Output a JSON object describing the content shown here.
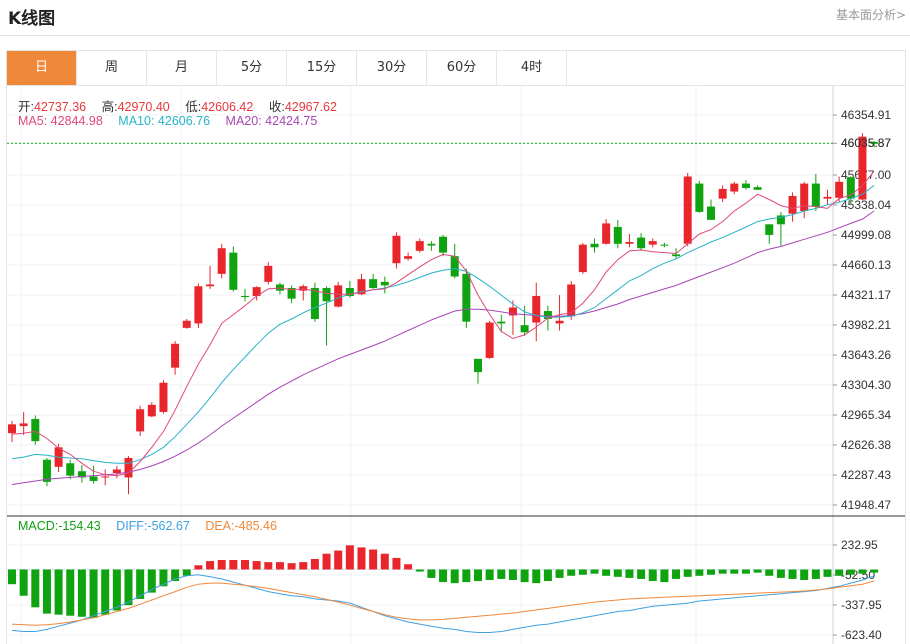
{
  "header": {
    "title": "K线图",
    "analysis_link": "基本面分析>"
  },
  "tabs": [
    {
      "label": "日",
      "active": true
    },
    {
      "label": "周",
      "active": false
    },
    {
      "label": "月",
      "active": false
    },
    {
      "label": "5分",
      "active": false
    },
    {
      "label": "15分",
      "active": false
    },
    {
      "label": "30分",
      "active": false
    },
    {
      "label": "60分",
      "active": false
    },
    {
      "label": "4时",
      "active": false
    }
  ],
  "quote": {
    "open_label": "开:",
    "open": "42737.36",
    "high_label": "高:",
    "high": "42970.40",
    "low_label": "低:",
    "low": "42606.42",
    "close_label": "收:",
    "close": "42967.62"
  },
  "ma_legend": {
    "ma5_label": "MA5:",
    "ma5": "42844.98",
    "ma10_label": "MA10:",
    "ma10": "42606.76",
    "ma20_label": "MA20:",
    "ma20": "42424.75"
  },
  "macd_legend": {
    "macd_label": "MACD:",
    "macd": "-154.43",
    "diff_label": "DIFF:",
    "diff": "-562.67",
    "dea_label": "DEA:",
    "dea": "-485.46"
  },
  "colors": {
    "up": "#e8262b",
    "down": "#0fa30f",
    "ma5": "#e0487a",
    "ma10": "#27b3c8",
    "ma20": "#a845b5",
    "diff": "#3fa0e0",
    "dea": "#f0883a",
    "current": "#12a012",
    "accent": "#f0883a"
  },
  "chart_data": {
    "type": "candlestick",
    "current_price": "46035.87",
    "price_axis": {
      "min": 41948.47,
      "max": 46354.91,
      "ticks": [
        "46354.91",
        "46035.87",
        "45677.00",
        "45338.04",
        "44999.08",
        "44660.13",
        "44321.17",
        "43982.21",
        "43643.26",
        "43304.30",
        "42965.34",
        "42626.38",
        "42287.43",
        "41948.47"
      ]
    },
    "macd_axis": {
      "min": -623.4,
      "max": 232.95,
      "ticks": [
        "232.95",
        "-52.50",
        "-337.95",
        "-623.40"
      ]
    },
    "candles": [
      {
        "o": 42760,
        "h": 42900,
        "l": 42660,
        "c": 42860
      },
      {
        "o": 42840,
        "h": 43000,
        "l": 42740,
        "c": 42870
      },
      {
        "o": 42920,
        "h": 42960,
        "l": 42630,
        "c": 42670
      },
      {
        "o": 42460,
        "h": 42480,
        "l": 42160,
        "c": 42210
      },
      {
        "o": 42380,
        "h": 42640,
        "l": 42320,
        "c": 42600
      },
      {
        "o": 42420,
        "h": 42460,
        "l": 42240,
        "c": 42280
      },
      {
        "o": 42330,
        "h": 42400,
        "l": 42200,
        "c": 42260
      },
      {
        "o": 42270,
        "h": 42390,
        "l": 42190,
        "c": 42220
      },
      {
        "o": 42260,
        "h": 42350,
        "l": 42170,
        "c": 42270
      },
      {
        "o": 42310,
        "h": 42390,
        "l": 42250,
        "c": 42350
      },
      {
        "o": 42260,
        "h": 42500,
        "l": 42070,
        "c": 42480
      },
      {
        "o": 42780,
        "h": 43070,
        "l": 42730,
        "c": 43030
      },
      {
        "o": 42950,
        "h": 43110,
        "l": 42940,
        "c": 43080
      },
      {
        "o": 43000,
        "h": 43360,
        "l": 42980,
        "c": 43330
      },
      {
        "o": 43500,
        "h": 43800,
        "l": 43420,
        "c": 43770
      },
      {
        "o": 43950,
        "h": 44050,
        "l": 43940,
        "c": 44030
      },
      {
        "o": 44000,
        "h": 44450,
        "l": 43950,
        "c": 44420
      },
      {
        "o": 44420,
        "h": 44650,
        "l": 44390,
        "c": 44440
      },
      {
        "o": 44560,
        "h": 44900,
        "l": 44510,
        "c": 44850
      },
      {
        "o": 44800,
        "h": 44870,
        "l": 44360,
        "c": 44380
      },
      {
        "o": 44310,
        "h": 44390,
        "l": 44250,
        "c": 44300
      },
      {
        "o": 44310,
        "h": 44420,
        "l": 44260,
        "c": 44410
      },
      {
        "o": 44470,
        "h": 44690,
        "l": 44440,
        "c": 44650
      },
      {
        "o": 44440,
        "h": 44460,
        "l": 44330,
        "c": 44370
      },
      {
        "o": 44400,
        "h": 44430,
        "l": 44230,
        "c": 44280
      },
      {
        "o": 44370,
        "h": 44440,
        "l": 44260,
        "c": 44420
      },
      {
        "o": 44400,
        "h": 44460,
        "l": 44020,
        "c": 44050
      },
      {
        "o": 44400,
        "h": 44420,
        "l": 43750,
        "c": 44250
      },
      {
        "o": 44190,
        "h": 44470,
        "l": 44180,
        "c": 44430
      },
      {
        "o": 44400,
        "h": 44480,
        "l": 44290,
        "c": 44310
      },
      {
        "o": 44330,
        "h": 44560,
        "l": 44320,
        "c": 44500
      },
      {
        "o": 44500,
        "h": 44560,
        "l": 44390,
        "c": 44400
      },
      {
        "o": 44470,
        "h": 44530,
        "l": 44340,
        "c": 44430
      },
      {
        "o": 44680,
        "h": 45030,
        "l": 44620,
        "c": 44990
      },
      {
        "o": 44730,
        "h": 44800,
        "l": 44710,
        "c": 44760
      },
      {
        "o": 44820,
        "h": 44960,
        "l": 44800,
        "c": 44930
      },
      {
        "o": 44900,
        "h": 44930,
        "l": 44820,
        "c": 44880
      },
      {
        "o": 44980,
        "h": 45000,
        "l": 44760,
        "c": 44800
      },
      {
        "o": 44760,
        "h": 44900,
        "l": 44510,
        "c": 44530
      },
      {
        "o": 44560,
        "h": 44620,
        "l": 43950,
        "c": 44020
      },
      {
        "o": 43600,
        "h": 43600,
        "l": 43320,
        "c": 43450
      },
      {
        "o": 43610,
        "h": 44030,
        "l": 43600,
        "c": 44010
      },
      {
        "o": 44020,
        "h": 44100,
        "l": 43900,
        "c": 44000
      },
      {
        "o": 44090,
        "h": 44260,
        "l": 43870,
        "c": 44180
      },
      {
        "o": 43980,
        "h": 44200,
        "l": 43860,
        "c": 43900
      },
      {
        "o": 44010,
        "h": 44460,
        "l": 43800,
        "c": 44310
      },
      {
        "o": 44140,
        "h": 44200,
        "l": 43920,
        "c": 44050
      },
      {
        "o": 44000,
        "h": 44320,
        "l": 43920,
        "c": 44030
      },
      {
        "o": 44080,
        "h": 44480,
        "l": 44040,
        "c": 44440
      },
      {
        "o": 44580,
        "h": 44910,
        "l": 44560,
        "c": 44890
      },
      {
        "o": 44900,
        "h": 44960,
        "l": 44800,
        "c": 44860
      },
      {
        "o": 44900,
        "h": 45180,
        "l": 44890,
        "c": 45130
      },
      {
        "o": 45090,
        "h": 45170,
        "l": 44850,
        "c": 44900
      },
      {
        "o": 44900,
        "h": 45010,
        "l": 44860,
        "c": 44920
      },
      {
        "o": 44970,
        "h": 45020,
        "l": 44820,
        "c": 44850
      },
      {
        "o": 44890,
        "h": 44960,
        "l": 44860,
        "c": 44930
      },
      {
        "o": 44890,
        "h": 44910,
        "l": 44860,
        "c": 44880
      },
      {
        "o": 44780,
        "h": 44850,
        "l": 44730,
        "c": 44760
      },
      {
        "o": 44900,
        "h": 45700,
        "l": 44870,
        "c": 45660
      },
      {
        "o": 45580,
        "h": 45610,
        "l": 45250,
        "c": 45260
      },
      {
        "o": 45320,
        "h": 45400,
        "l": 45170,
        "c": 45170
      },
      {
        "o": 45410,
        "h": 45560,
        "l": 45370,
        "c": 45520
      },
      {
        "o": 45490,
        "h": 45600,
        "l": 45460,
        "c": 45580
      },
      {
        "o": 45580,
        "h": 45620,
        "l": 45510,
        "c": 45530
      },
      {
        "o": 45540,
        "h": 45560,
        "l": 45510,
        "c": 45510
      },
      {
        "o": 45120,
        "h": 45120,
        "l": 44900,
        "c": 45000
      },
      {
        "o": 45220,
        "h": 45260,
        "l": 44880,
        "c": 45120
      },
      {
        "o": 45240,
        "h": 45480,
        "l": 45150,
        "c": 45440
      },
      {
        "o": 45270,
        "h": 45600,
        "l": 45190,
        "c": 45580
      },
      {
        "o": 45580,
        "h": 45690,
        "l": 45270,
        "c": 45320
      },
      {
        "o": 45410,
        "h": 45510,
        "l": 45340,
        "c": 45430
      },
      {
        "o": 45420,
        "h": 45660,
        "l": 45370,
        "c": 45600
      },
      {
        "o": 45650,
        "h": 45660,
        "l": 45350,
        "c": 45410
      },
      {
        "o": 45400,
        "h": 46150,
        "l": 45390,
        "c": 46110
      },
      {
        "o": 46050,
        "h": 46060,
        "l": 45990,
        "c": 46030
      }
    ],
    "ma5": [
      42750,
      42760,
      42780,
      42700,
      42590,
      42520,
      42420,
      42330,
      42290,
      42280,
      42310,
      42440,
      42600,
      42780,
      43020,
      43290,
      43540,
      43760,
      44000,
      44100,
      44200,
      44310,
      44390,
      44400,
      44380,
      44390,
      44370,
      44340,
      44330,
      44330,
      44350,
      44380,
      44390,
      44460,
      44550,
      44640,
      44720,
      44780,
      44760,
      44590,
      44320,
      44100,
      43910,
      43830,
      43870,
      43960,
      44060,
      44100,
      44120,
      44230,
      44380,
      44580,
      44720,
      44820,
      44830,
      44810,
      44800,
      44790,
      44900,
      45010,
      45060,
      45150,
      45270,
      45360,
      45460,
      45400,
      45330,
      45300,
      45330,
      45320,
      45300,
      45410,
      45450,
      45560,
      45720
    ],
    "ma10": [
      42470,
      42490,
      42520,
      42510,
      42490,
      42480,
      42470,
      42450,
      42430,
      42420,
      42420,
      42460,
      42520,
      42600,
      42720,
      42860,
      43000,
      43160,
      43330,
      43480,
      43620,
      43760,
      43890,
      43990,
      44050,
      44120,
      44180,
      44230,
      44290,
      44330,
      44360,
      44380,
      44400,
      44430,
      44470,
      44520,
      44570,
      44600,
      44620,
      44590,
      44510,
      44420,
      44320,
      44220,
      44130,
      44090,
      44070,
      44070,
      44080,
      44120,
      44180,
      44280,
      44380,
      44480,
      44540,
      44620,
      44680,
      44730,
      44800,
      44860,
      44920,
      44970,
      45030,
      45090,
      45150,
      45180,
      45200,
      45230,
      45270,
      45300,
      45340,
      45370,
      45410,
      45460,
      45560
    ],
    "ma20": [
      42180,
      42200,
      42220,
      42240,
      42250,
      42260,
      42270,
      42280,
      42290,
      42300,
      42320,
      42350,
      42390,
      42440,
      42500,
      42570,
      42650,
      42740,
      42840,
      42930,
      43020,
      43110,
      43200,
      43280,
      43350,
      43420,
      43480,
      43540,
      43600,
      43650,
      43700,
      43750,
      43800,
      43860,
      43920,
      43980,
      44040,
      44090,
      44140,
      44160,
      44160,
      44150,
      44130,
      44110,
      44100,
      44090,
      44080,
      44080,
      44090,
      44110,
      44140,
      44180,
      44220,
      44270,
      44310,
      44350,
      44390,
      44430,
      44480,
      44530,
      44580,
      44630,
      44680,
      44740,
      44800,
      44840,
      44870,
      44910,
      44950,
      44990,
      45030,
      45080,
      45130,
      45180,
      45270
    ],
    "macd": [
      -140,
      -250,
      -360,
      -420,
      -430,
      -440,
      -450,
      -460,
      -430,
      -390,
      -340,
      -280,
      -220,
      -160,
      -110,
      -60,
      40,
      80,
      90,
      90,
      90,
      80,
      70,
      70,
      60,
      70,
      100,
      150,
      180,
      230,
      210,
      190,
      150,
      110,
      50,
      -20,
      -80,
      -120,
      -130,
      -120,
      -110,
      -100,
      -90,
      -100,
      -120,
      -130,
      -110,
      -80,
      -60,
      -50,
      -40,
      -60,
      -70,
      -80,
      -90,
      -110,
      -120,
      -90,
      -70,
      -60,
      -50,
      -40,
      -40,
      -40,
      -30,
      -60,
      -80,
      -90,
      -100,
      -90,
      -70,
      -60,
      -50,
      -40,
      -30
    ],
    "diff": [
      -580,
      -590,
      -590,
      -570,
      -540,
      -510,
      -480,
      -440,
      -400,
      -360,
      -310,
      -250,
      -190,
      -140,
      -90,
      -60,
      -50,
      -70,
      -90,
      -120,
      -150,
      -180,
      -210,
      -230,
      -250,
      -260,
      -280,
      -290,
      -300,
      -320,
      -360,
      -400,
      -440,
      -470,
      -500,
      -520,
      -540,
      -560,
      -570,
      -590,
      -600,
      -600,
      -590,
      -570,
      -550,
      -530,
      -520,
      -500,
      -480,
      -460,
      -440,
      -420,
      -400,
      -390,
      -370,
      -350,
      -340,
      -330,
      -320,
      -300,
      -290,
      -280,
      -270,
      -260,
      -250,
      -240,
      -230,
      -220,
      -210,
      -200,
      -180,
      -160,
      -130,
      -100,
      -60
    ],
    "dea": [
      -520,
      -525,
      -530,
      -525,
      -515,
      -500,
      -480,
      -460,
      -430,
      -400,
      -370,
      -330,
      -290,
      -250,
      -210,
      -170,
      -140,
      -130,
      -130,
      -140,
      -150,
      -165,
      -180,
      -200,
      -220,
      -240,
      -260,
      -285,
      -310,
      -340,
      -370,
      -400,
      -430,
      -455,
      -470,
      -480,
      -480,
      -475,
      -465,
      -455,
      -445,
      -435,
      -425,
      -415,
      -400,
      -385,
      -370,
      -355,
      -340,
      -325,
      -310,
      -300,
      -290,
      -280,
      -275,
      -270,
      -265,
      -260,
      -255,
      -250,
      -245,
      -240,
      -235,
      -230,
      -225,
      -220,
      -215,
      -210,
      -205,
      -195,
      -185,
      -170,
      -155,
      -140,
      -110
    ]
  }
}
